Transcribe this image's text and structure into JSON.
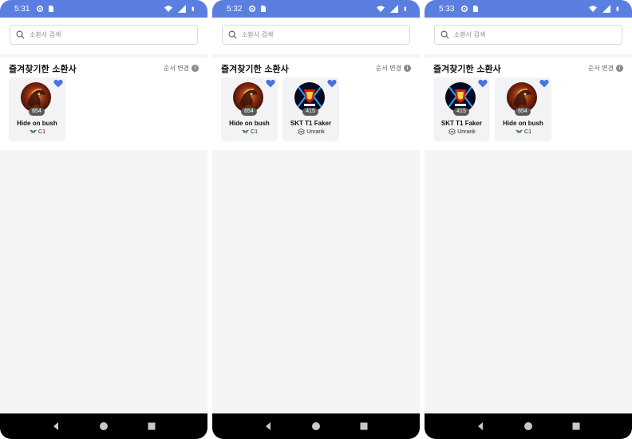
{
  "screens": [
    {
      "status": {
        "time": "5:31"
      },
      "search": {
        "placeholder": "소환사 검색"
      },
      "favorites": {
        "title": "즐겨찾기한 소환사",
        "reorder_label": "순서 변경",
        "cards": [
          {
            "name": "Hide on bush",
            "level": "654",
            "tier": "C1",
            "portrait": "dragon-portrait-icon",
            "tier_icon": "challenger-emblem-icon"
          }
        ]
      }
    },
    {
      "status": {
        "time": "5:32"
      },
      "search": {
        "placeholder": "소환사 검색"
      },
      "favorites": {
        "title": "즐겨찾기한 소환사",
        "reorder_label": "순서 변경",
        "cards": [
          {
            "name": "Hide on bush",
            "level": "654",
            "tier": "C1",
            "portrait": "dragon-portrait-icon",
            "tier_icon": "challenger-emblem-icon"
          },
          {
            "name": "SKT T1 Faker",
            "level": "415",
            "tier": "Unrank",
            "portrait": "skt-2016-portrait-icon",
            "tier_icon": "unranked-emblem-icon"
          }
        ]
      }
    },
    {
      "status": {
        "time": "5:33"
      },
      "search": {
        "placeholder": "소환사 검색"
      },
      "favorites": {
        "title": "즐겨찾기한 소환사",
        "reorder_label": "순서 변경",
        "cards": [
          {
            "name": "SKT T1 Faker",
            "level": "415",
            "tier": "Unrank",
            "portrait": "skt-2016-portrait-icon",
            "tier_icon": "unranked-emblem-icon"
          },
          {
            "name": "Hide on bush",
            "level": "654",
            "tier": "C1",
            "portrait": "dragon-portrait-icon",
            "tier_icon": "challenger-emblem-icon"
          }
        ]
      }
    }
  ],
  "colors": {
    "status_bar": "#5b7fe0",
    "heart": "#4a72e0",
    "card_bg": "#f3f3f5",
    "nav_bar": "#000000"
  }
}
